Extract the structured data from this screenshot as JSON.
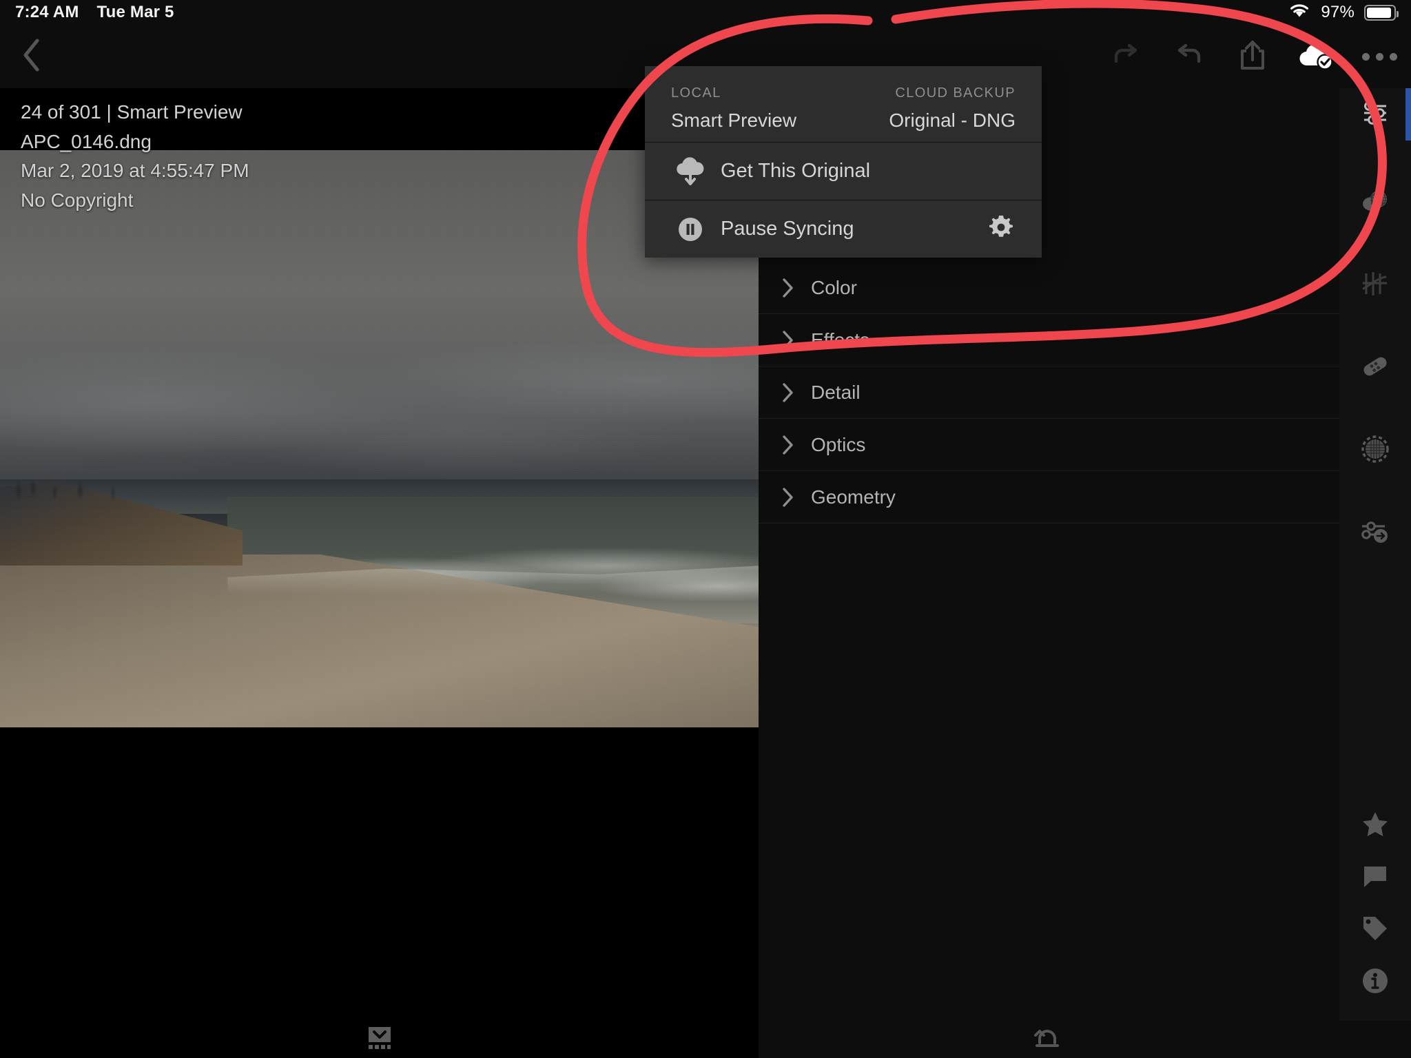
{
  "statusbar": {
    "time": "7:24 AM",
    "date": "Tue Mar 5",
    "battery_percent": "97%",
    "wifi_icon": "wifi-icon",
    "battery_icon": "battery-icon"
  },
  "toolbar": {
    "back_icon": "chevron-left-icon",
    "redo_icon": "redo-icon",
    "undo_icon": "undo-icon",
    "share_icon": "share-icon",
    "cloud_status_icon": "cloud-check-icon",
    "more_icon": "more-ellipsis-icon"
  },
  "photo": {
    "counter": "24 of 301 | Smart Preview",
    "filename": "APC_0146.dng",
    "capture_date": "Mar 2, 2019 at 4:55:47 PM",
    "copyright": "No Copyright"
  },
  "popover": {
    "local_label": "LOCAL",
    "cloud_label": "CLOUD BACKUP",
    "local_value": "Smart Preview",
    "cloud_value": "Original - DNG",
    "items": [
      {
        "label": "Get This Original",
        "icon": "cloud-download-icon",
        "trailing_icon": ""
      },
      {
        "label": "Pause Syncing",
        "icon": "pause-circle-icon",
        "trailing_icon": "gear-icon"
      }
    ]
  },
  "edit_panel": {
    "sections": [
      {
        "label": "Color",
        "chevron": "chevron-right-icon"
      },
      {
        "label": "Effects",
        "chevron": "chevron-right-icon"
      },
      {
        "label": "Detail",
        "chevron": "chevron-right-icon"
      },
      {
        "label": "Optics",
        "chevron": "chevron-right-icon"
      },
      {
        "label": "Geometry",
        "chevron": "chevron-right-icon"
      }
    ]
  },
  "rail": {
    "top_items": [
      {
        "icon": "edit-sliders-icon",
        "active": true
      },
      {
        "icon": "crop-masking-icon",
        "active": false
      },
      {
        "icon": "curve-icon",
        "active": false
      },
      {
        "icon": "healing-brush-icon",
        "active": false
      },
      {
        "icon": "radial-mask-icon",
        "active": false
      },
      {
        "icon": "presets-icon",
        "active": false
      }
    ],
    "bottom_items": [
      {
        "icon": "star-icon"
      },
      {
        "icon": "comment-icon"
      },
      {
        "icon": "tag-icon"
      },
      {
        "icon": "info-icon"
      }
    ],
    "accent_color": "#2b55a8"
  },
  "bottom_bar": {
    "filmstrip_icon": "filmstrip-toggle-icon",
    "reset_icon": "revert-icon"
  },
  "annotation": {
    "color": "#f0464e",
    "shape": "hand-drawn-ellipse"
  }
}
